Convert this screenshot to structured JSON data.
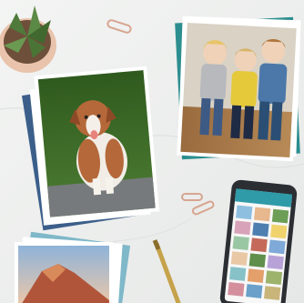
{
  "scene": {
    "description_name": "photo-prints-flatlay",
    "colors": {
      "surface": "#eef0ee",
      "pot": "#e8c7b0",
      "plant": "#4f7a3c",
      "grass": "#3f6d2a",
      "dog_fur": "#b5683a",
      "wood_floor": "#a87a4a",
      "phone_body": "#2b2e33",
      "paper_clip": "#d7a58f",
      "pen_gold": "#c6a24b"
    },
    "icons": [
      "succulent-plant",
      "paper-clip",
      "gold-pen",
      "smartphone"
    ]
  }
}
